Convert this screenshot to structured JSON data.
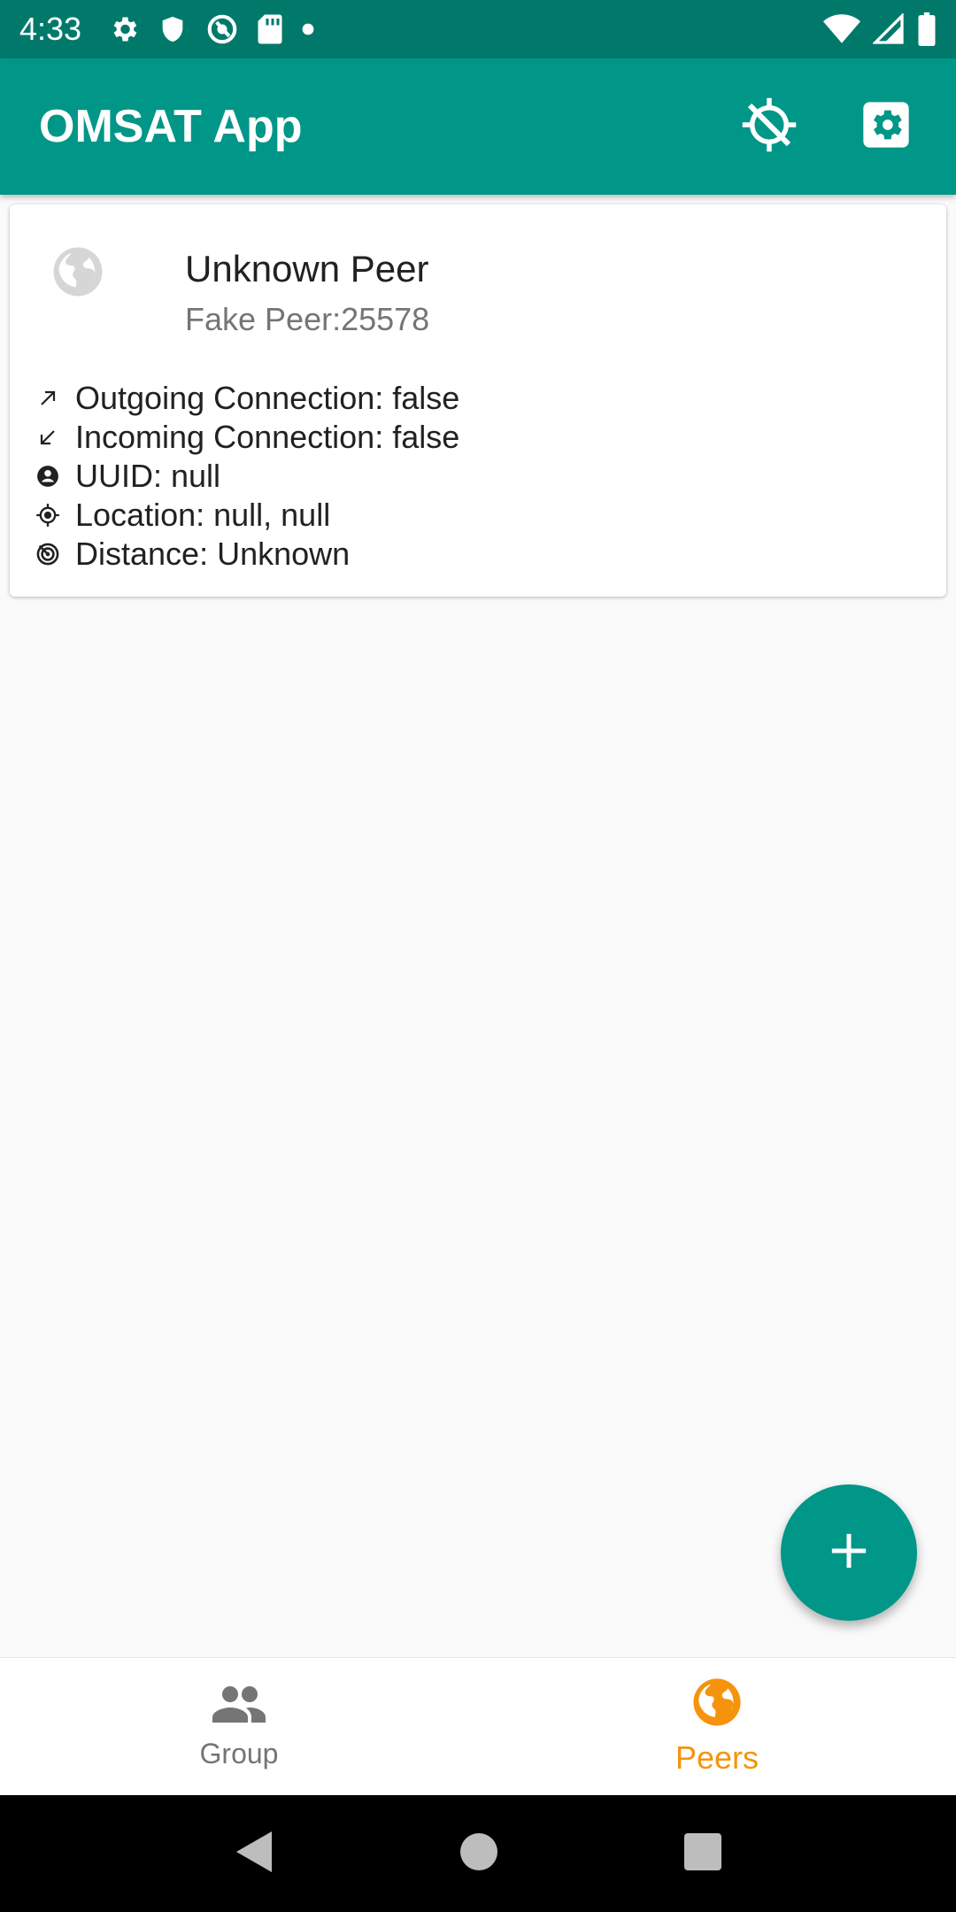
{
  "status_bar": {
    "time": "4:33",
    "left_icons": [
      "gear-icon",
      "shield-icon",
      "sync-blocked-icon",
      "sd-card-icon",
      "dot-icon"
    ],
    "right_icons": [
      "wifi-icon",
      "signal-icon",
      "battery-icon"
    ]
  },
  "app_bar": {
    "title": "OMSAT App",
    "actions": [
      "location-disabled-icon",
      "settings-icon"
    ]
  },
  "peer": {
    "name": "Unknown Peer",
    "subtitle": "Fake Peer:25578",
    "details": [
      {
        "icon": "arrow-outgoing-icon",
        "text": "Outgoing Connection: false"
      },
      {
        "icon": "arrow-incoming-icon",
        "text": "Incoming Connection: false"
      },
      {
        "icon": "account-circle-icon",
        "text": "UUID: null"
      },
      {
        "icon": "location-target-icon",
        "text": "Location: null, null"
      },
      {
        "icon": "distance-radar-icon",
        "text": "Distance: Unknown"
      }
    ]
  },
  "fab": {
    "icon": "plus-icon"
  },
  "bottom_nav": {
    "items": [
      {
        "label": "Group",
        "icon": "group-icon",
        "active": false
      },
      {
        "label": "Peers",
        "icon": "globe-icon",
        "active": true
      }
    ]
  },
  "colors": {
    "primary": "#009688",
    "primary_dark": "#00796b",
    "accent": "#f5940c",
    "inactive": "#757575"
  }
}
